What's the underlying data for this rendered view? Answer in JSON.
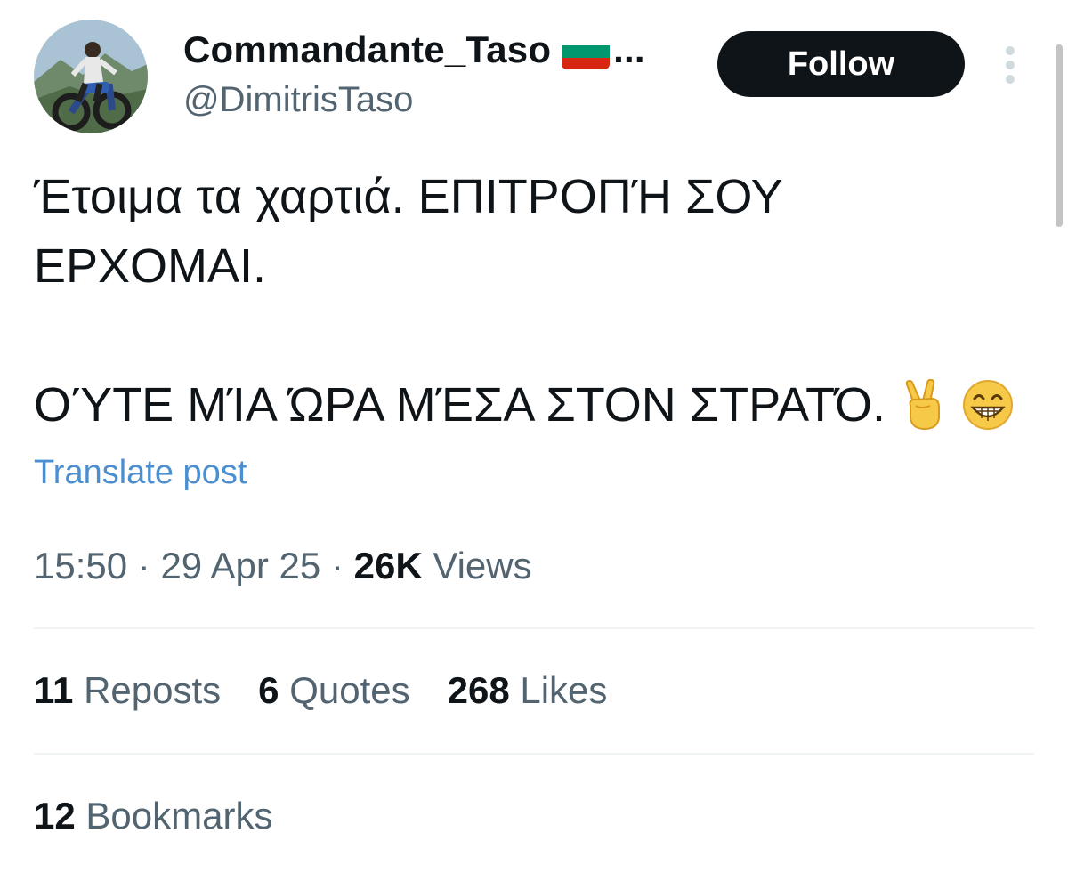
{
  "author": {
    "display_name": "Commandante_Taso",
    "flag": "bulgaria-flag",
    "truncation": "...",
    "handle": "@DimitrisTaso",
    "avatar": "avatar-photo"
  },
  "follow_button": {
    "label": "Follow"
  },
  "more_menu": {
    "icon": "more-vertical-icon"
  },
  "post": {
    "line1": "Έτοιμα τα χαρτιά. ΕΠΙΤΡΟΠΉ ΣΟΥ",
    "line2": "ΕΡΧΟΜΑΙ.",
    "line3": "ΟΎΤΕ ΜΊΑ ΏΡΑ ΜΈΣΑ ΣΤΟΝ ΣΤΡΑΤΌ.",
    "emojis": [
      "victory-hand-emoji",
      "grinning-face-emoji"
    ]
  },
  "translate_link": "Translate post",
  "meta": {
    "time": "15:50",
    "separator": "·",
    "date": "29 Apr 25",
    "views_count": "26K",
    "views_label": "Views"
  },
  "stats": {
    "reposts": {
      "count": "11",
      "label": "Reposts"
    },
    "quotes": {
      "count": "6",
      "label": "Quotes"
    },
    "likes": {
      "count": "268",
      "label": "Likes"
    },
    "bookmarks": {
      "count": "12",
      "label": "Bookmarks"
    }
  },
  "colors": {
    "text_primary": "#0f1419",
    "text_secondary": "#536471",
    "link": "#4b8fd1",
    "button_bg": "#0f1419",
    "divider": "#eff3f4",
    "flag_white": "#ffffff",
    "flag_green": "#00966e",
    "flag_red": "#d62612"
  }
}
